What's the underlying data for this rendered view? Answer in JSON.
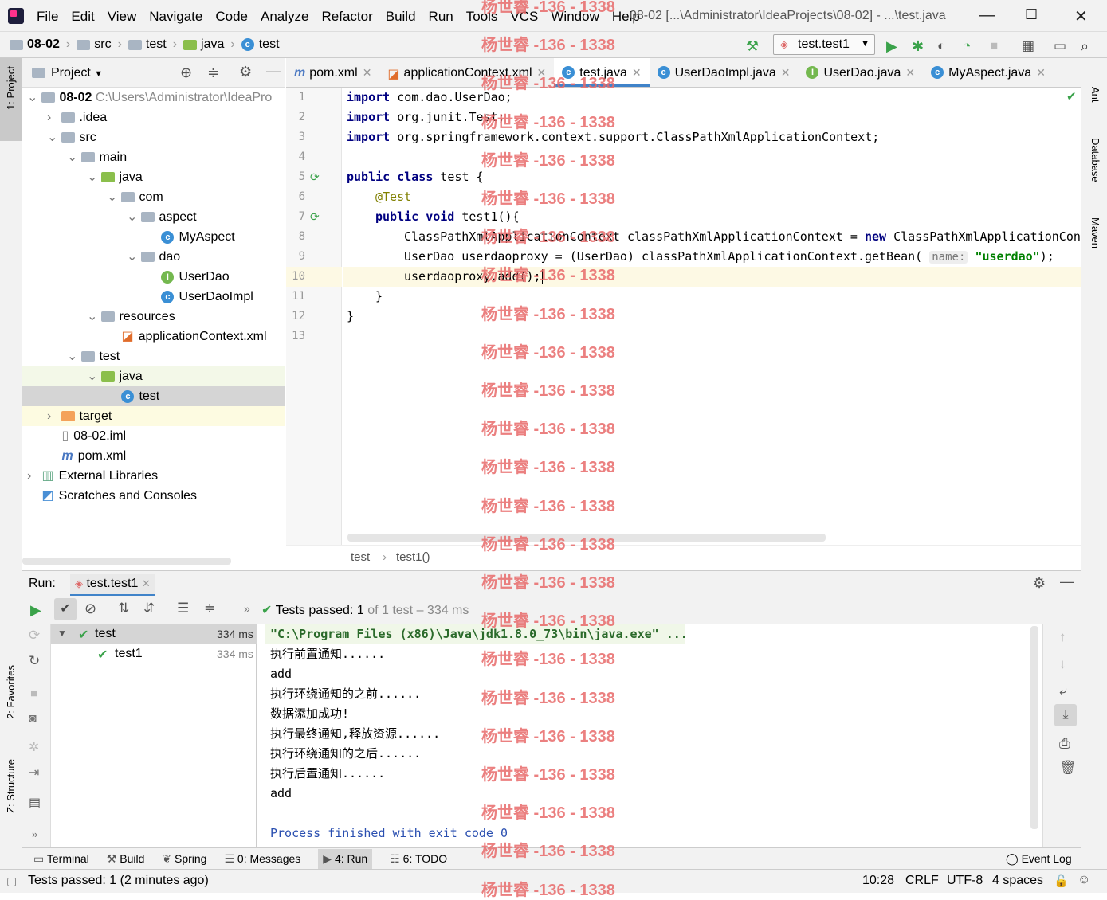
{
  "menu": [
    "File",
    "Edit",
    "View",
    "Navigate",
    "Code",
    "Analyze",
    "Refactor",
    "Build",
    "Run",
    "Tools",
    "VCS",
    "Window",
    "Help"
  ],
  "window_title": "08-02 [...\\Administrator\\IdeaProjects\\08-02] - ...\\test.java",
  "breadcrumb": [
    "08-02",
    "src",
    "test",
    "java",
    "test"
  ],
  "run_config": "test.test1",
  "project_panel": {
    "title": "Project"
  },
  "tree": [
    {
      "label": "08-02",
      "extra": "C:\\Users\\Administrator\\IdeaPro",
      "indent": 0,
      "arrow": "v",
      "icon": "module"
    },
    {
      "label": ".idea",
      "indent": 1,
      "arrow": ">",
      "icon": "folder"
    },
    {
      "label": "src",
      "indent": 1,
      "arrow": "v",
      "icon": "folder"
    },
    {
      "label": "main",
      "indent": 2,
      "arrow": "v",
      "icon": "folder"
    },
    {
      "label": "java",
      "indent": 3,
      "arrow": "v",
      "icon": "java"
    },
    {
      "label": "com",
      "indent": 4,
      "arrow": "v",
      "icon": "folder"
    },
    {
      "label": "aspect",
      "indent": 5,
      "arrow": "v",
      "icon": "folder"
    },
    {
      "label": "MyAspect",
      "indent": 6,
      "arrow": "",
      "icon": "class"
    },
    {
      "label": "dao",
      "indent": 5,
      "arrow": "v",
      "icon": "folder"
    },
    {
      "label": "UserDao",
      "indent": 6,
      "arrow": "",
      "icon": "interface"
    },
    {
      "label": "UserDaoImpl",
      "indent": 6,
      "arrow": "",
      "icon": "class"
    },
    {
      "label": "resources",
      "indent": 3,
      "arrow": "v",
      "icon": "folder"
    },
    {
      "label": "applicationContext.xml",
      "indent": 4,
      "arrow": "",
      "icon": "xml"
    },
    {
      "label": "test",
      "indent": 2,
      "arrow": "v",
      "icon": "folder"
    },
    {
      "label": "java",
      "indent": 3,
      "arrow": "v",
      "icon": "java"
    },
    {
      "label": "test",
      "indent": 4,
      "arrow": "",
      "icon": "class"
    },
    {
      "label": "target",
      "indent": 1,
      "arrow": ">",
      "icon": "target"
    },
    {
      "label": "08-02.iml",
      "indent": 1,
      "arrow": "",
      "icon": "file"
    },
    {
      "label": "pom.xml",
      "indent": 1,
      "arrow": "",
      "icon": "maven"
    },
    {
      "label": "External Libraries",
      "indent": 0,
      "arrow": ">",
      "icon": "lib"
    },
    {
      "label": "Scratches and Consoles",
      "indent": 0,
      "arrow": "",
      "icon": "scratch"
    }
  ],
  "tabs": [
    {
      "label": "pom.xml",
      "icon": "m"
    },
    {
      "label": "applicationContext.xml",
      "icon": "xml"
    },
    {
      "label": "test.java",
      "icon": "c",
      "active": true
    },
    {
      "label": "UserDaoImpl.java",
      "icon": "c"
    },
    {
      "label": "UserDao.java",
      "icon": "i"
    },
    {
      "label": "MyAspect.java",
      "icon": "c"
    }
  ],
  "code_lines": [
    "1",
    "2",
    "3",
    "4",
    "5",
    "6",
    "7",
    "8",
    "9",
    "10",
    "11",
    "12",
    "13"
  ],
  "code": {
    "l1a": "import",
    "l1b": " com.dao.UserDao;",
    "l2a": "import",
    "l2b": " org.junit.Test;",
    "l3a": "import",
    "l3b": " org.springframework.context.support.ClassPathXmlApplicationContext;",
    "l5a": "public class",
    "l5b": " test {",
    "l6": "@Test",
    "l7a": "public void",
    "l7b": " test1(){",
    "l8a": "ClassPathXmlApplicationContext classPathXmlApplicationContext = ",
    "l8b": "new",
    "l8c": " ClassPathXmlApplicationCont",
    "l9a": "UserDao userdaoproxy = (UserDao) classPathXmlApplicationContext.getBean( ",
    "l9hint": "name:",
    "l9str": "\"userdao\"",
    "l9c": ");",
    "l10": "userdaoproxy.add();",
    "l11": "}",
    "l12": "}"
  },
  "editor_breadcrumb": [
    "test",
    "test1()"
  ],
  "run": {
    "label": "Run:",
    "tab": "test.test1",
    "status_prefix": "Tests passed:",
    "status_count": "1",
    "status_suffix": "of 1 test – 334 ms",
    "tree": [
      {
        "label": "test",
        "time": "334 ms"
      },
      {
        "label": "test1",
        "time": "334 ms"
      }
    ],
    "console": [
      "\"C:\\Program Files (x86)\\Java\\jdk1.8.0_73\\bin\\java.exe\" ...",
      "执行前置通知......",
      "add",
      "执行环绕通知的之前......",
      "数据添加成功!",
      "执行最终通知,释放资源......",
      "执行环绕通知的之后......",
      "执行后置通知......",
      "add",
      "",
      "Process finished with exit code 0"
    ]
  },
  "bottom_tabs": [
    "Terminal",
    "Build",
    "Spring",
    "0: Messages",
    "4: Run",
    "6: TODO"
  ],
  "event_log": "Event Log",
  "status_bar": {
    "left": "Tests passed: 1 (2 minutes ago)",
    "pos": "10:28",
    "eol": "CRLF",
    "enc": "UTF-8",
    "indent": "4 spaces"
  },
  "left_tabs": [
    "1: Project",
    "2: Favorites",
    "Z: Structure"
  ],
  "right_tabs": [
    "Ant",
    "Database",
    "Maven"
  ],
  "watermark": "杨世睿 -136 - 1338"
}
